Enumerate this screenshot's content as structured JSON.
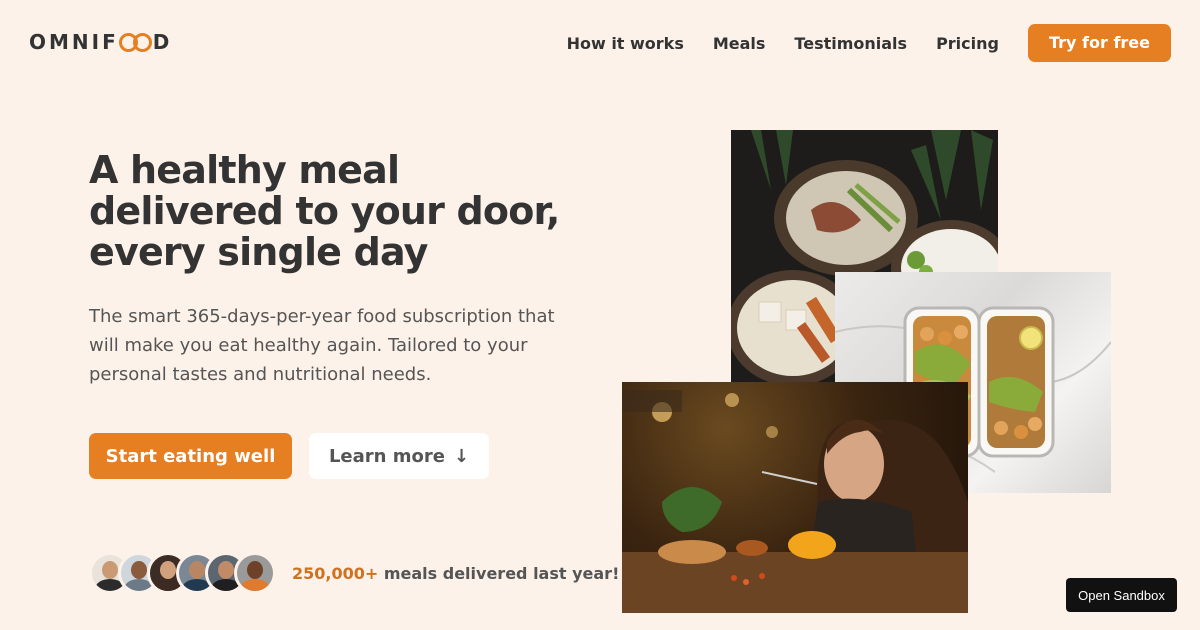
{
  "header": {
    "logo_text_before": "OMNIF",
    "logo_text_after": "D",
    "nav": [
      {
        "label": "How it works"
      },
      {
        "label": "Meals"
      },
      {
        "label": "Testimonials"
      },
      {
        "label": "Pricing"
      }
    ],
    "cta_label": "Try for free"
  },
  "hero": {
    "title": "A healthy meal delivered to your door, every single day",
    "description": "The smart 365-days-per-year food subscription that will make you eat healthy again. Tailored to your personal tastes and nutritional needs.",
    "primary_button": "Start eating well",
    "secondary_button": "Learn more",
    "secondary_arrow": "↓"
  },
  "delivered": {
    "count": "250,000+",
    "text": " meals delivered last year!"
  },
  "sandbox": {
    "label": "Open Sandbox"
  },
  "colors": {
    "brand": "#e67e22",
    "background": "#fdf2e9",
    "text": "#333333"
  }
}
